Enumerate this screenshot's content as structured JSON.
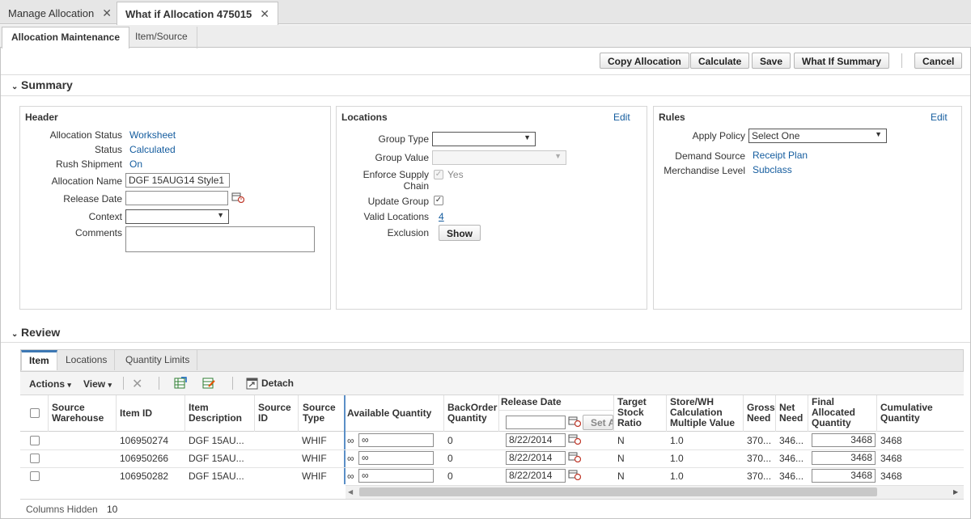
{
  "doc_tabs": [
    {
      "label": "Manage Allocation"
    },
    {
      "label": "What if Allocation 475015"
    }
  ],
  "sub_tabs": [
    {
      "label": "Allocation Maintenance"
    },
    {
      "label": "Item/Source"
    }
  ],
  "actions": {
    "copy": "Copy Allocation",
    "calculate": "Calculate",
    "save": "Save",
    "summary": "What If Summary",
    "cancel": "Cancel"
  },
  "summary": {
    "title": "Summary",
    "header": {
      "title": "Header",
      "allocation_status_label": "Allocation Status",
      "allocation_status": "Worksheet",
      "status_label": "Status",
      "status": "Calculated",
      "rush_label": "Rush Shipment",
      "rush": "On",
      "name_label": "Allocation Name",
      "name": "DGF 15AUG14 Style1",
      "release_label": "Release Date",
      "release": "",
      "context_label": "Context",
      "context": "",
      "comments_label": "Comments",
      "comments": ""
    },
    "locations": {
      "title": "Locations",
      "edit": "Edit",
      "group_type_label": "Group Type",
      "group_type": "",
      "group_value_label": "Group Value",
      "group_value": "",
      "enforce_label_1": "Enforce Supply",
      "enforce_label_2": "Chain",
      "enforce_value": "Yes",
      "update_group_label": "Update Group",
      "valid_label": "Valid Locations",
      "valid_value": "4",
      "exclusion_label": "Exclusion",
      "show_button": "Show"
    },
    "rules": {
      "title": "Rules",
      "edit": "Edit",
      "apply_policy_label": "Apply Policy",
      "apply_policy": "Select One",
      "demand_label": "Demand Source",
      "demand": "Receipt Plan",
      "merch_label": "Merchandise Level",
      "merch": "Subclass"
    }
  },
  "review": {
    "title": "Review",
    "tabs": [
      {
        "label": "Item"
      },
      {
        "label": "Locations"
      },
      {
        "label": "Quantity Limits"
      }
    ],
    "toolbar": {
      "actions": "Actions",
      "view": "View",
      "detach": "Detach"
    },
    "columns": {
      "source_warehouse_1": "Source",
      "source_warehouse_2": "Warehouse",
      "item_id": "Item ID",
      "item_desc_1": "Item",
      "item_desc_2": "Description",
      "source_id_1": "Source",
      "source_id_2": "ID",
      "source_type_1": "Source",
      "source_type_2": "Type",
      "available": "Available Quantity",
      "backorder_1": "BackOrder",
      "backorder_2": "Quantity",
      "release": "Release Date",
      "set_all": "Set A",
      "target_1": "Target",
      "target_2": "Stock",
      "target_3": "Ratio",
      "store_wh_1": "Store/WH",
      "store_wh_2": "Calculation",
      "store_wh_3": "Multiple Value",
      "gross_1": "Gross",
      "gross_2": "Need",
      "net_1": "Net",
      "net_2": "Need",
      "final_1": "Final",
      "final_2": "Allocated",
      "final_3": "Quantity",
      "cumulative_1": "Cumulative",
      "cumulative_2": "Quantity"
    },
    "rows": [
      {
        "item_id": "106950274",
        "desc": "DGF 15AU...",
        "source_type": "WHIF",
        "available_prefix": "∞",
        "available": "∞",
        "backorder": "0",
        "release": "8/22/2014",
        "target": "N",
        "store_wh": "1.0",
        "gross": "370...",
        "net": "346...",
        "final": "3468",
        "cumulative": "3468"
      },
      {
        "item_id": "106950266",
        "desc": "DGF 15AU...",
        "source_type": "WHIF",
        "available_prefix": "∞",
        "available": "∞",
        "backorder": "0",
        "release": "8/22/2014",
        "target": "N",
        "store_wh": "1.0",
        "gross": "370...",
        "net": "346...",
        "final": "3468",
        "cumulative": "3468"
      },
      {
        "item_id": "106950282",
        "desc": "DGF 15AU...",
        "source_type": "WHIF",
        "available_prefix": "∞",
        "available": "∞",
        "backorder": "0",
        "release": "8/22/2014",
        "target": "N",
        "store_wh": "1.0",
        "gross": "370...",
        "net": "346...",
        "final": "3468",
        "cumulative": "3468"
      }
    ],
    "columns_hidden_label": "Columns Hidden",
    "columns_hidden_value": "10"
  },
  "colors": {
    "link": "#145c9e",
    "active_tab_accent": "#3c78b4"
  }
}
